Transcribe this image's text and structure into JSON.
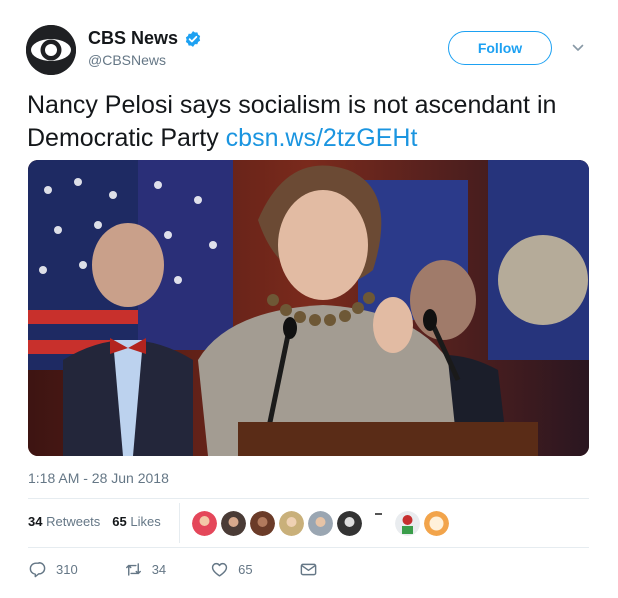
{
  "account": {
    "name": "CBS News",
    "handle": "@CBSNews",
    "verified": true
  },
  "follow_label": "Follow",
  "tweet": {
    "text": "Nancy Pelosi says socialism is not ascendant in Democratic Party ",
    "link": "cbsn.ws/2tzGEHt"
  },
  "timestamp": "1:18 AM - 28 Jun 2018",
  "stats": {
    "retweets_count": "34",
    "retweets_label": "Retweets",
    "likes_count": "65",
    "likes_label": "Likes"
  },
  "actions": {
    "replies": "310",
    "retweets": "34",
    "likes": "65"
  },
  "colors": {
    "accent": "#1da1f2",
    "link": "#1b95e0",
    "secondary_text": "#657786"
  }
}
